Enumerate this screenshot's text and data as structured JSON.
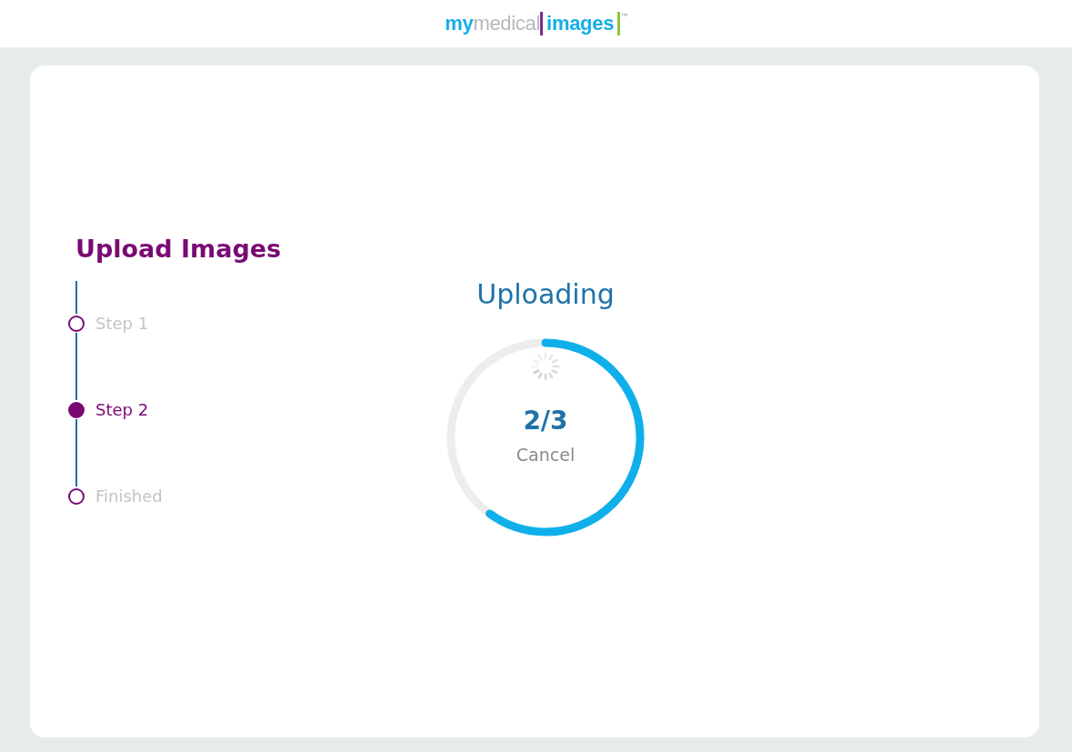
{
  "header": {
    "logo": {
      "prefix": "my",
      "middle": "medical",
      "brand": "images",
      "mark": "™"
    }
  },
  "sidebar": {
    "title": "Upload Images",
    "steps": [
      {
        "label": "Step 1",
        "selected": false
      },
      {
        "label": "Step 2",
        "selected": true
      },
      {
        "label": "Finished",
        "selected": false
      }
    ]
  },
  "upload": {
    "title": "Uploading",
    "level": 0.6,
    "count": "2/3",
    "cancel": "Cancel"
  }
}
